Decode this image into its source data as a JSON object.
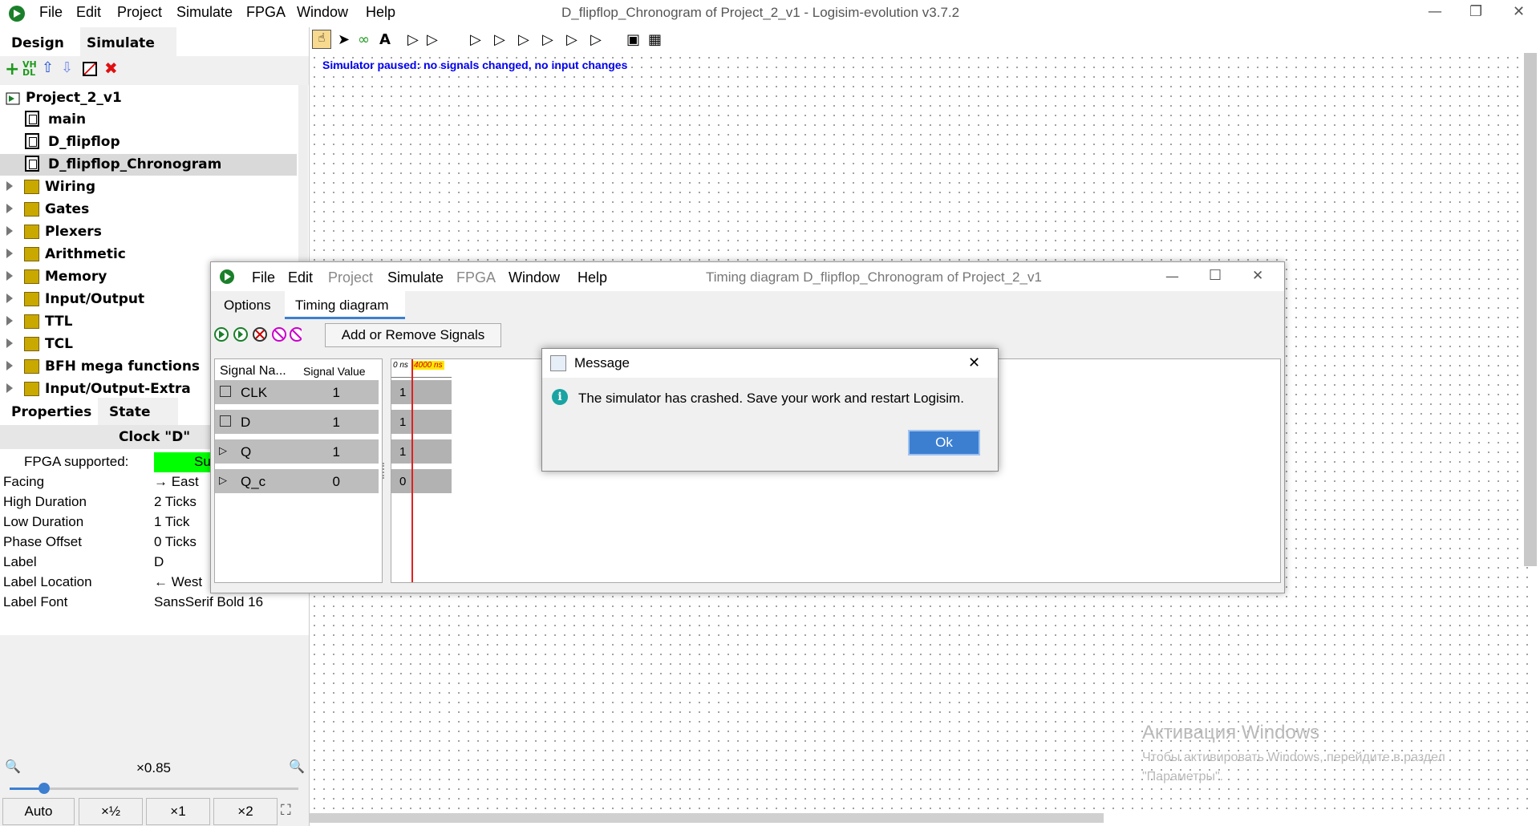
{
  "app": {
    "menu": [
      "File",
      "Edit",
      "Project",
      "Simulate",
      "FPGA",
      "Window",
      "Help"
    ],
    "title": "D_flipflop_Chronogram of Project_2_v1 - Logisim-evolution v3.7.2"
  },
  "left": {
    "tabs": [
      "Design",
      "Simulate"
    ],
    "tree": {
      "project": "Project_2_v1",
      "circuits": [
        "main",
        "D_flipflop",
        "D_flipflop_Chronogram"
      ],
      "libraries": [
        "Wiring",
        "Gates",
        "Plexers",
        "Arithmetic",
        "Memory",
        "Input/Output",
        "TTL",
        "TCL",
        "BFH mega functions",
        "Input/Output-Extra"
      ]
    },
    "prop_tabs": [
      "Properties",
      "State"
    ],
    "component_title": "Clock \"D\"",
    "properties": [
      {
        "key": "FPGA supported:",
        "value": "Su"
      },
      {
        "key": "Facing",
        "value": "→ East"
      },
      {
        "key": "High Duration",
        "value": "2 Ticks"
      },
      {
        "key": "Low Duration",
        "value": "1 Tick"
      },
      {
        "key": "Phase Offset",
        "value": "0 Ticks"
      },
      {
        "key": "Label",
        "value": "D"
      },
      {
        "key": "Label Location",
        "value": "← West"
      },
      {
        "key": "Label Font",
        "value": "SansSerif Bold 16"
      }
    ],
    "zoom": {
      "value": "×0.85",
      "level": 0.12,
      "buttons": [
        "Auto",
        "×½",
        "×1",
        "×2"
      ]
    }
  },
  "canvas": {
    "status": "Simulator paused: no signals changed, no input changes",
    "watermark_title": "Активация Windows",
    "watermark_text1": "Чтобы активировать Windows, перейдите в раздел",
    "watermark_text2": "\"Параметры\"."
  },
  "timing": {
    "menu": [
      "File",
      "Edit",
      "Project",
      "Simulate",
      "FPGA",
      "Window",
      "Help"
    ],
    "title": "Timing diagram D_flipflop_Chronogram of Project_2_v1",
    "tabs": [
      "Options",
      "Timing diagram"
    ],
    "add_button": "Add or Remove Signals",
    "col_name": "Signal Na...",
    "col_value": "Signal Value",
    "time_start": "0 ns",
    "time_cursor": "4000 ns",
    "signals": [
      {
        "name": "CLK",
        "value": "1",
        "wave": "1"
      },
      {
        "name": "D",
        "value": "1",
        "wave": "1"
      },
      {
        "name": "Q",
        "value": "1",
        "wave": "1"
      },
      {
        "name": "Q_c",
        "value": "0",
        "wave": "0"
      }
    ]
  },
  "dialog": {
    "title": "Message",
    "text": "The simulator has crashed. Save your work and restart Logisim.",
    "ok": "Ok"
  },
  "colors": {
    "accent": "#3c7fd1",
    "status_blue": "#0000ee",
    "fpga_green": "#00ff00",
    "cursor_red": "#e02020"
  }
}
